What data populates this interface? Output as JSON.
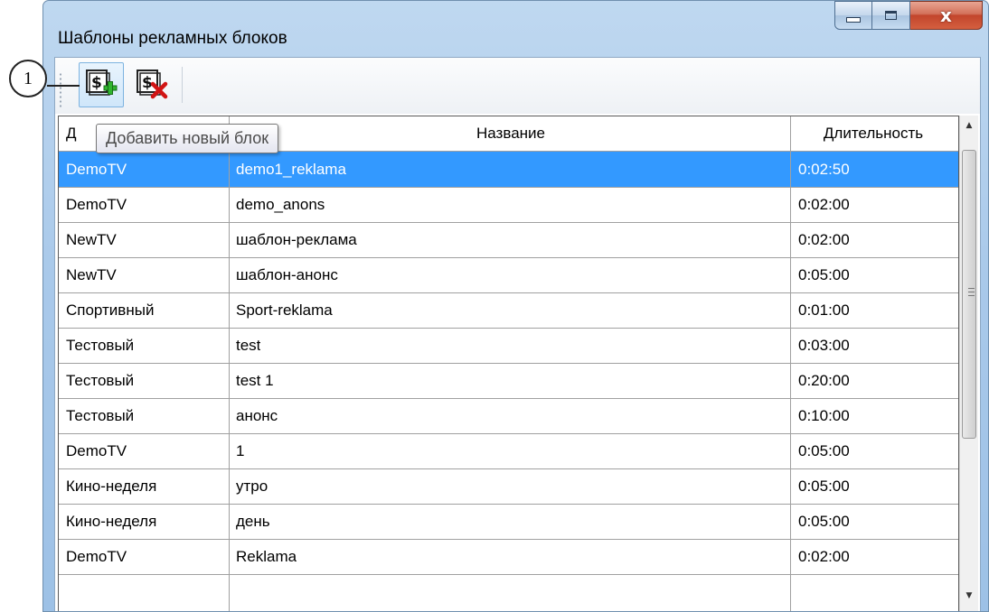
{
  "callout": {
    "number": "1"
  },
  "window": {
    "title": "Шаблоны рекламных блоков",
    "buttons": {
      "minimize": "minimize",
      "maximize": "maximize",
      "close": "x"
    }
  },
  "toolbar": {
    "add_icon": "add-block-icon",
    "delete_icon": "delete-block-icon",
    "tooltip": "Добавить новый блок"
  },
  "table": {
    "columns": [
      "Д",
      "Название",
      "Длительность"
    ],
    "selected_row": 0,
    "rows": [
      {
        "channel": "DemoTV",
        "name": "demo1_reklama",
        "duration": "0:02:50"
      },
      {
        "channel": "DemoTV",
        "name": "demo_anons",
        "duration": "0:02:00"
      },
      {
        "channel": "NewTV",
        "name": "шаблон-реклама",
        "duration": "0:02:00"
      },
      {
        "channel": "NewTV",
        "name": "шаблон-анонс",
        "duration": "0:05:00"
      },
      {
        "channel": "Спортивный",
        "name": "Sport-reklama",
        "duration": "0:01:00"
      },
      {
        "channel": "Тестовый",
        "name": "test",
        "duration": "0:03:00"
      },
      {
        "channel": "Тестовый",
        "name": "test 1",
        "duration": "0:20:00"
      },
      {
        "channel": "Тестовый",
        "name": "анонс",
        "duration": "0:10:00"
      },
      {
        "channel": "DemoTV",
        "name": "1",
        "duration": "0:05:00"
      },
      {
        "channel": "Кино-неделя",
        "name": "утро",
        "duration": "0:05:00"
      },
      {
        "channel": "Кино-неделя",
        "name": "день",
        "duration": "0:05:00"
      },
      {
        "channel": "DemoTV",
        "name": "Reklama",
        "duration": "0:02:00"
      }
    ]
  },
  "colors": {
    "selection": "#3399ff",
    "title_bar": "#a9c9ea",
    "close_button": "#c2452c"
  }
}
